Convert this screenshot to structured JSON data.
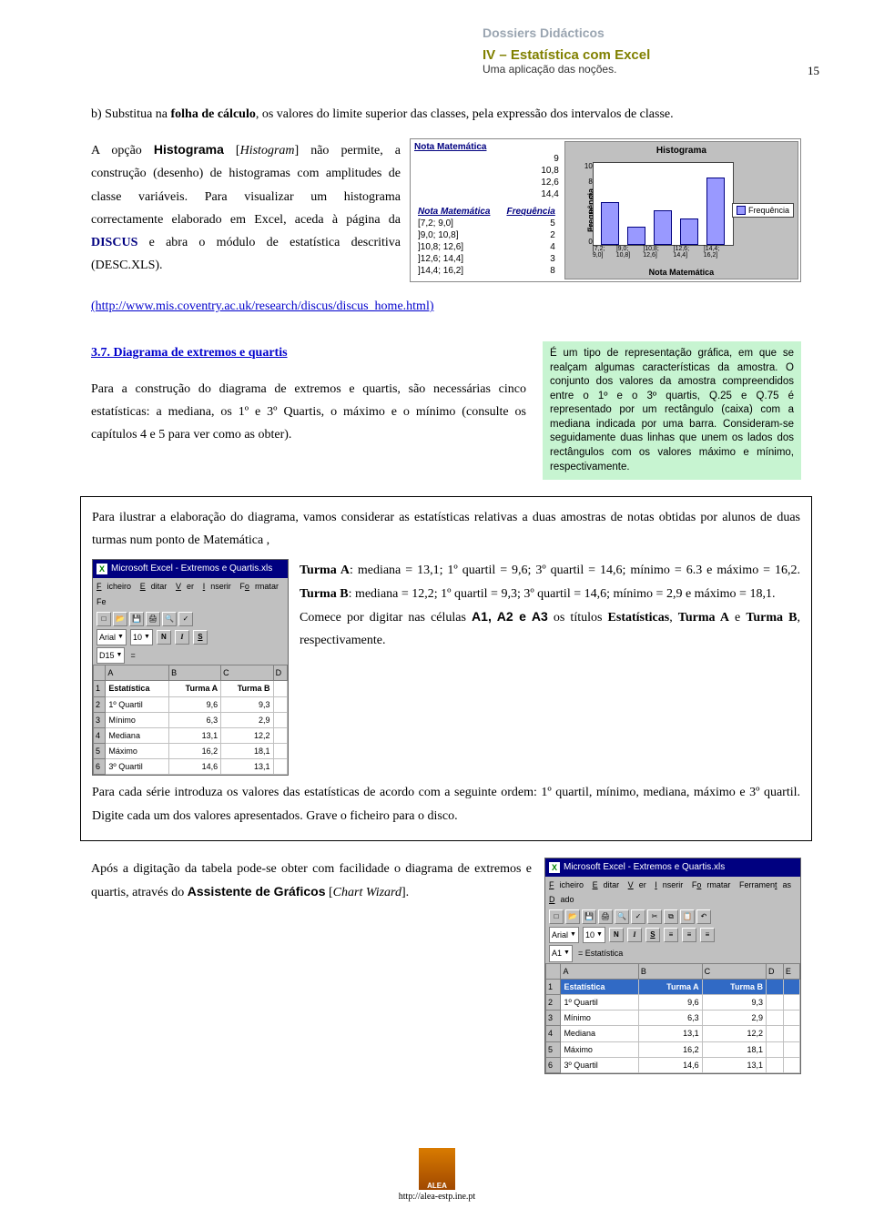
{
  "header": {
    "dossiers": "Dossiers Didácticos",
    "title": "IV – Estatística com Excel",
    "subtitle": "Uma aplicação das noções.",
    "page": "15"
  },
  "intro": {
    "p1a": "b) Substitua na ",
    "p1b": "folha de cálculo",
    "p1c": ", os valores do limite superior das classes, pela expressão dos intervalos de classe.",
    "p2a": "A opção ",
    "p2b": "Histograma",
    "p2c": " [",
    "p2d": "Histogram",
    "p2e": "] não permite, a construção (desenho) de histogramas com amplitudes de classe variáveis. Para visualizar um histograma correctamente elaborado em Excel, aceda à página da ",
    "p2f": "DISCUS",
    "p2g": " e abra o módulo de estatística descritiva (DESC.XLS)."
  },
  "chart_data": {
    "type": "bar",
    "title": "Histograma",
    "xlabel": "Nota Matemática",
    "ylabel": "Frequência",
    "legend": "Frequência",
    "ylim": [
      0,
      10
    ],
    "yticks": [
      "10",
      "8",
      "6",
      "4",
      "2",
      "0"
    ],
    "nota_values": [
      "9",
      "10,8",
      "12,6",
      "14,4"
    ],
    "freq_table": {
      "headers": [
        "Nota Matemática",
        "Frequência"
      ],
      "rows": [
        [
          "[7,2; 9,0]",
          "5"
        ],
        [
          "]9,0; 10,8]",
          "2"
        ],
        [
          "]10,8; 12,6]",
          "4"
        ],
        [
          "]12,6; 14,4]",
          "3"
        ],
        [
          "]14,4; 16,2]",
          "8"
        ]
      ]
    },
    "xtick_labels": [
      "[7,2; 9,0]",
      "]9,0; 10,8]",
      "]10,8; 12,6]",
      "]12,6; 14,4]",
      "]14,4; 16,2]"
    ],
    "values": [
      5,
      2,
      4,
      3,
      8
    ]
  },
  "discus_link": "(http://www.mis.coventry.ac.uk/research/discus/discus_home.html)",
  "section37": {
    "title": "3.7. Diagrama de extremos e quartis",
    "p": "Para a construção do diagrama de extremos e quartis, são necessárias cinco estatísticas: a mediana, os 1º e 3º Quartis, o máximo e o mínimo (consulte os capítulos 4 e 5 para ver como as obter)."
  },
  "greenbox": "É um tipo de representação gráfica, em que se realçam algumas características da amostra. O conjunto dos valores da amostra compreendidos entre o 1º e o 3º quartis, Q.25 e Q.75 é representado por um rectângulo (caixa) com a mediana indicada por uma barra. Consideram-se seguidamente duas linhas que unem os lados dos rectângulos com os valores máximo e mínimo, respectivamente.",
  "framed": {
    "lead": "Para ilustrar a elaboração do diagrama, vamos considerar as estatísticas relativas a duas amostras de notas obtidas por alunos de duas turmas num ponto de Matemática , ",
    "turmaA": "Turma A",
    "ta_data": ": mediana = 13,1; 1º quartil = 9,6; 3º quartil = 14,6; mínimo = 6.3 e máximo = 16,2. ",
    "turmaB": "Turma B",
    "tb_data": ": mediana = 12,2; 1º quartil = 9,3; 3º quartil = 14,6; mínimo = 2,9 e máximo = 18,1.",
    "comece_a": "Comece por digitar nas células ",
    "comece_b": "A1, A2 e A3",
    "comece_c": " os títulos ",
    "comece_d": "Estatísticas",
    "comece_e": ", ",
    "comece_f": "Turma A",
    "comece_g": " e ",
    "comece_h": "Turma B",
    "comece_i": ", respectivamente.",
    "p3": "Para cada série introduza os valores das estatísticas de acordo com a seguinte ordem: 1º quartil, mínimo, mediana, máximo e 3º quartil. Digite cada um dos valores apresentados. Grave o ficheiro para o disco."
  },
  "excel_shot": {
    "title": "Microsoft Excel - Extremos e Quartis.xls",
    "menu": {
      "file": "Ficheiro",
      "edit": "Editar",
      "view": "Ver",
      "insert": "Inserir",
      "format": "Formatar",
      "tools": "Fe"
    },
    "font": "Arial",
    "size": "10",
    "cellref": "D15",
    "equals": "=",
    "columns": [
      "",
      "A",
      "B",
      "C",
      "D"
    ],
    "rows": [
      [
        "1",
        "Estatística",
        "Turma A",
        "Turma B",
        ""
      ],
      [
        "2",
        "1º Quartil",
        "9,6",
        "9,3",
        ""
      ],
      [
        "3",
        "Mínimo",
        "6,3",
        "2,9",
        ""
      ],
      [
        "4",
        "Mediana",
        "13,1",
        "12,2",
        ""
      ],
      [
        "5",
        "Máximo",
        "16,2",
        "18,1",
        ""
      ],
      [
        "6",
        "3º Quartil",
        "14,6",
        "13,1",
        ""
      ]
    ]
  },
  "excel_shot2": {
    "title": "Microsoft Excel - Extremos e Quartis.xls",
    "menu": {
      "file": "Ficheiro",
      "edit": "Editar",
      "view": "Ver",
      "insert": "Inserir",
      "format": "Formatar",
      "tools": "Ferramentas",
      "data": "Dado"
    },
    "font": "Arial",
    "size": "10",
    "cellref": "A1",
    "equals": "= Estatística",
    "columns": [
      "",
      "A",
      "B",
      "C",
      "D",
      "E"
    ],
    "rows": [
      [
        "1",
        "Estatística",
        "Turma A",
        "Turma B",
        "",
        ""
      ],
      [
        "2",
        "1º Quartil",
        "9,6",
        "9,3",
        "",
        ""
      ],
      [
        "3",
        "Mínimo",
        "6,3",
        "2,9",
        "",
        ""
      ],
      [
        "4",
        "Mediana",
        "13,1",
        "12,2",
        "",
        ""
      ],
      [
        "5",
        "Máximo",
        "16,2",
        "18,1",
        "",
        ""
      ],
      [
        "6",
        "3º Quartil",
        "14,6",
        "13,1",
        "",
        ""
      ]
    ]
  },
  "after_frame": {
    "p1": "Após a digitação da tabela pode-se obter com facilidade o diagrama de extremos e quartis, através do ",
    "p2": "Assistente de Gráficos",
    "p3": " [",
    "p4": "Chart Wizard",
    "p5": "]."
  },
  "footer": {
    "logo": "ALEA",
    "url": "http://alea-estp.ine.pt"
  }
}
